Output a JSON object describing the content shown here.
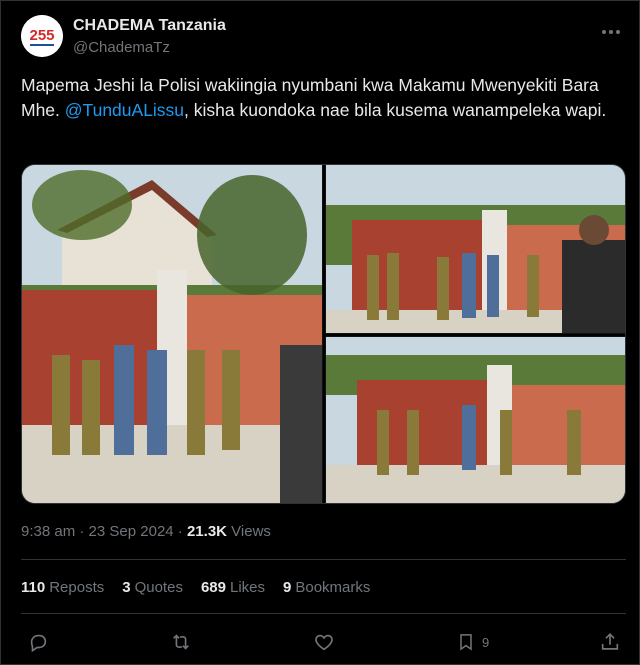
{
  "account": {
    "display_name": "CHADEMA Tanzania",
    "handle": "@ChademaTz",
    "avatar_text": "255"
  },
  "tweet": {
    "text_before": "Mapema Jeshi la Polisi wakiingia nyumbani kwa Makamu Mwenyekiti Bara Mhe. ",
    "mention": "@TunduALissu",
    "text_after": ", kisha kuondoka nae bila kusema wanampeleka wapi.",
    "time": "9:38 am",
    "date": "23 Sep 2024",
    "views_count": "21.3K",
    "views_label": "Views",
    "separator": "·"
  },
  "stats": {
    "reposts_count": "110",
    "reposts_label": "Reposts",
    "quotes_count": "3",
    "quotes_label": "Quotes",
    "likes_count": "689",
    "likes_label": "Likes",
    "bookmarks_count": "9",
    "bookmarks_label": "Bookmarks"
  },
  "actions": {
    "bookmark_count": "9"
  },
  "colors": {
    "background": "#000000",
    "text_primary": "#e7e9ea",
    "text_secondary": "#71767b",
    "accent": "#1d9bf0",
    "border": "#2f3336"
  },
  "icons": [
    "more-icon",
    "reply-icon",
    "repost-icon",
    "like-icon",
    "bookmark-icon",
    "share-icon"
  ]
}
